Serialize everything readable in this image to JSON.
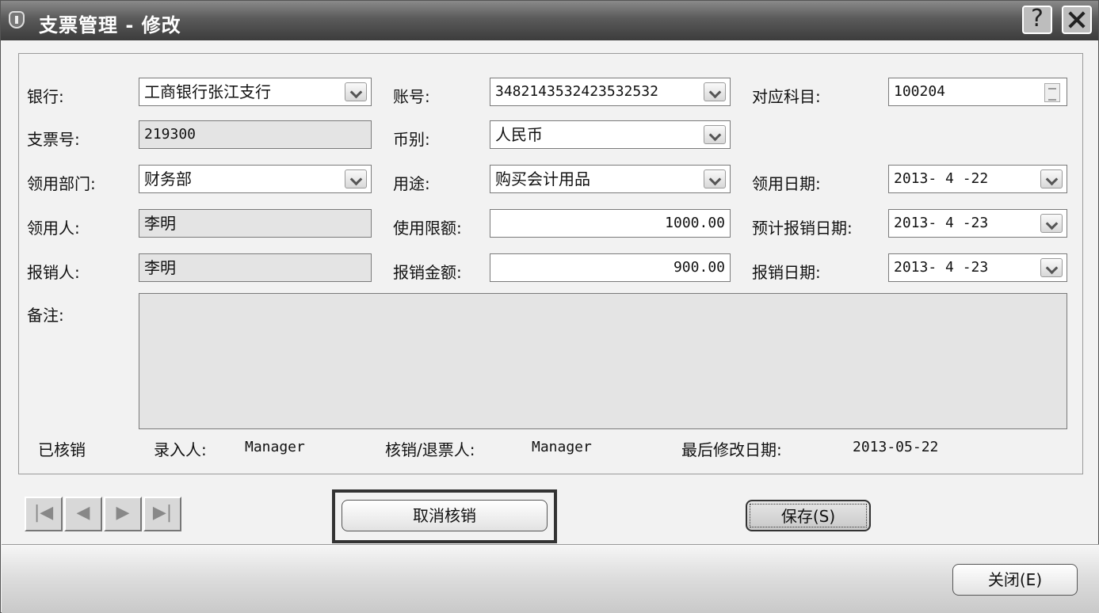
{
  "window": {
    "title": "支票管理 - 修改",
    "help_label": "?"
  },
  "form": {
    "bank": {
      "label": "银行:",
      "value": "工商银行张江支行"
    },
    "account": {
      "label": "账号:",
      "value": "3482143532423532532"
    },
    "subject": {
      "label": "对应科目:",
      "value": "100204"
    },
    "cheque_no": {
      "label": "支票号:",
      "value": "219300"
    },
    "currency": {
      "label": "币别:",
      "value": "人民币"
    },
    "department": {
      "label": "领用部门:",
      "value": "财务部"
    },
    "purpose": {
      "label": "用途:",
      "value": "购买会计用品"
    },
    "receive_date": {
      "label": "领用日期:",
      "value": "2013- 4 -22"
    },
    "receiver": {
      "label": "领用人:",
      "value": "李明"
    },
    "limit": {
      "label": "使用限额:",
      "value": "1000.00"
    },
    "expected_date": {
      "label": "预计报销日期:",
      "value": "2013- 4 -23"
    },
    "reimburser": {
      "label": "报销人:",
      "value": "李明"
    },
    "amount": {
      "label": "报销金额:",
      "value": "900.00"
    },
    "reimburse_date": {
      "label": "报销日期:",
      "value": "2013- 4 -23"
    },
    "remark": {
      "label": "备注:",
      "value": ""
    }
  },
  "status": {
    "state": "已核销",
    "entered_by_label": "录入人:",
    "entered_by": "Manager",
    "cancelled_by_label": "核销/退票人:",
    "cancelled_by": "Manager",
    "modified_label": "最后修改日期:",
    "modified_date": "2013-05-22"
  },
  "nav": {
    "first": "|◀",
    "prev": "◀",
    "next": "▶",
    "last": "▶|"
  },
  "actions": {
    "cancel_writeoff": "取消核销",
    "save": "保存(S)",
    "close": "关闭(E)"
  }
}
